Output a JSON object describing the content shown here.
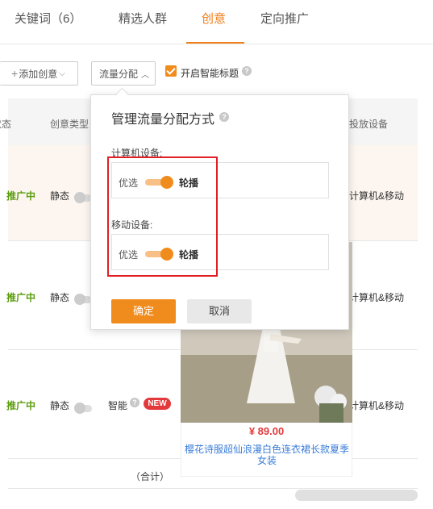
{
  "tabs": [
    {
      "label": "关键词（6）"
    },
    {
      "label": "精选人群"
    },
    {
      "label": "创意"
    },
    {
      "label": "定向推广"
    }
  ],
  "toolbar": {
    "add_creative": "添加创意",
    "traffic_dist": "流量分配",
    "smart_title": "开启智能标题",
    "smart_title_checked": true
  },
  "table": {
    "headers": {
      "status": "状态",
      "type": "创意类型",
      "device": "投放设备"
    },
    "rows": [
      {
        "status": "推广中",
        "type": "静态",
        "device": "计算机&移动"
      },
      {
        "status": "推广中",
        "type": "静态",
        "device": "计算机&移动"
      },
      {
        "status": "推广中",
        "type": "静态",
        "smart": "智能",
        "badge": "NEW",
        "device": "计算机&移动"
      }
    ],
    "total": "（合计）"
  },
  "product": {
    "price": "¥ 89.00",
    "title": "樱花诗服超仙浪漫白色连衣裙长款夏季女装"
  },
  "modal": {
    "title": "管理流量分配方式",
    "pc_label": "计算机设备:",
    "mobile_label": "移动设备:",
    "opt_left": "优选",
    "opt_right": "轮播",
    "pc_value": "轮播",
    "mobile_value": "轮播",
    "confirm": "确定",
    "cancel": "取消"
  },
  "colors": {
    "accent": "#f08c1d",
    "status_green": "#5a9d0d",
    "highlight_red": "#e11e24"
  }
}
